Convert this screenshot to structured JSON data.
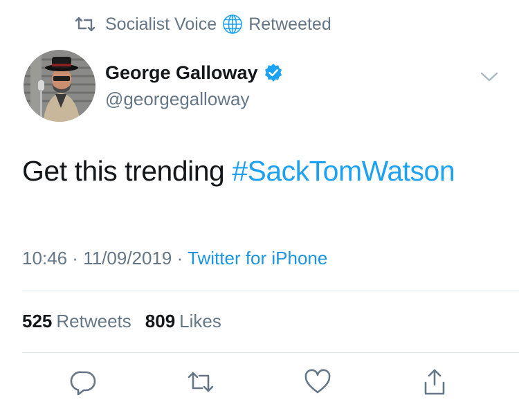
{
  "retweet_context": {
    "account": "Socialist Voice",
    "suffix": "Retweeted",
    "icon": "retweet-icon",
    "globe_icon": "globe-icon"
  },
  "author": {
    "name": "George Galloway",
    "handle": "@georgegalloway",
    "verified_icon": "verified-badge-icon",
    "avatar": "avatar"
  },
  "tweet": {
    "text": "Get this trending ",
    "hashtag": "#SackTomWatson"
  },
  "meta": {
    "time": "10:46",
    "sep1": " · ",
    "date": "11/09/2019",
    "sep2": " · ",
    "source": "Twitter for iPhone"
  },
  "stats": {
    "retweets_count": "525",
    "retweets_label": "Retweets",
    "likes_count": "809",
    "likes_label": "Likes"
  },
  "actions": [
    "reply-icon",
    "retweet-icon",
    "like-icon",
    "share-icon"
  ],
  "colors": {
    "accent": "#1da1f2",
    "link": "#1b95e0",
    "secondary_text": "#657786",
    "primary_text": "#14171a",
    "divider": "#e1e8ed"
  }
}
